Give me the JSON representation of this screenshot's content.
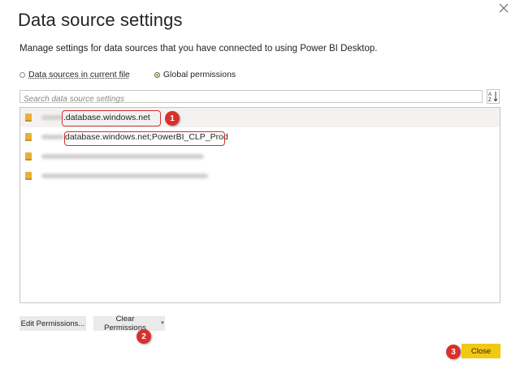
{
  "dialog": {
    "title": "Data source settings",
    "description": "Manage settings for data sources that you have connected to using Power BI Desktop."
  },
  "scope": {
    "options": [
      "Data sources in current file",
      "Global permissions"
    ],
    "selected": "Global permissions"
  },
  "search": {
    "placeholder": "Search data source settings"
  },
  "sort_icon": "sort-az-icon",
  "data_sources": [
    {
      "label": ".database.windows.net",
      "selected": true,
      "icon": "database-icon"
    },
    {
      "label": "database.windows.net;PowerBI_CLP_Prod",
      "selected": false,
      "icon": "database-icon"
    },
    {
      "label": "",
      "selected": false,
      "icon": "database-icon"
    },
    {
      "label": "",
      "selected": false,
      "icon": "database-icon"
    }
  ],
  "buttons": {
    "edit_permissions": "Edit Permissions...",
    "clear_permissions": "Clear Permissions",
    "close": "Close"
  },
  "annotations": [
    "1",
    "2",
    "3"
  ],
  "colors": {
    "accent": "#f2c811",
    "annotation": "#d9302c",
    "selected_row": "#f3f2f1"
  }
}
